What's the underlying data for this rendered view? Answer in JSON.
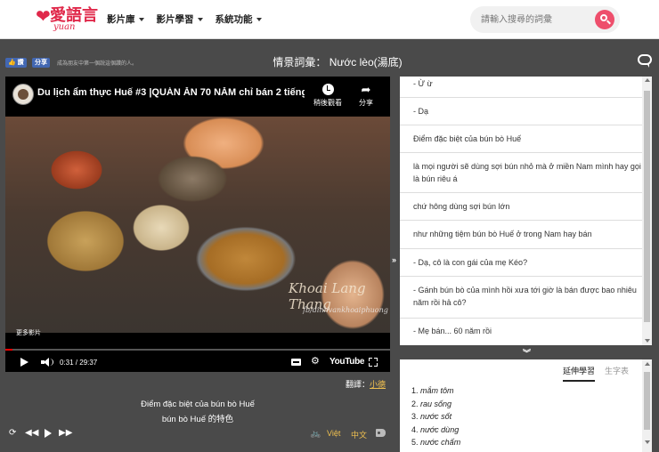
{
  "brand": {
    "logo_text": "愛語言",
    "logo_sub": "yuan",
    "accent": "#e0284a"
  },
  "nav": {
    "items": [
      {
        "label": "影片庫"
      },
      {
        "label": "影片學習"
      },
      {
        "label": "系統功能"
      }
    ]
  },
  "search": {
    "placeholder": "請輸入搜尋的詞彙",
    "icon": "search-icon"
  },
  "social": {
    "like_label": "讚",
    "share_label": "分享",
    "note": "成為朋友中第一個說這個讚的人。"
  },
  "page": {
    "title": "情景詞彙： Nước lèo(湯底)"
  },
  "video": {
    "title": "Du lịch ẩm thực Huế #3 |QUÁN ĂN 70 NĂM chỉ bán 2 tiếng mỗi...",
    "watch_later_label": "稍後觀看",
    "share_label": "分享",
    "more_videos_label": "更多影片",
    "time": "0:31 / 29:37",
    "progress_fraction": 0.0174,
    "brand_label": "YouTube",
    "watermark": "Khoai Lang Thang",
    "watermark_sub": "fb/dinhvankhoaiphuong"
  },
  "translate": {
    "label": "翻譯：",
    "link": "小德"
  },
  "current_sub": {
    "vi": "Điểm đặc biệt của bún bò Huế",
    "zh": "bún bò Huế 的特色"
  },
  "sub_controls": {
    "lang_vi": "Việt",
    "lang_zh": "中文"
  },
  "subtitle_list": [
    {
      "text": "- Ừ ừ"
    },
    {
      "text": "- Dạ"
    },
    {
      "text": "Điểm đặc biệt của bún bò Huế"
    },
    {
      "text": "là mọi người sẽ dùng sợi bún nhỏ mà ở miền Nam mình hay gọi là bún riêu á"
    },
    {
      "text": "chứ hông dùng sợi bún lớn"
    },
    {
      "text": "như những tiệm bún bò Huế ở trong Nam hay bán"
    },
    {
      "text": "- Dạ, cô là con gái của mẹ Kéo?"
    },
    {
      "text": "- Gánh bún bò của mình hồi xưa tới giờ là bán được bao nhiêu năm rồi hả cô?"
    },
    {
      "text": "- Mẹ bán... 60 năm rồi"
    }
  ],
  "vocab_panel": {
    "tabs": [
      {
        "label": "延伸學習"
      },
      {
        "label": "生字表"
      }
    ],
    "words": [
      {
        "num": "1.",
        "word": "mắm tôm"
      },
      {
        "num": "2.",
        "word": "rau sống"
      },
      {
        "num": "3.",
        "word": "nước sốt"
      },
      {
        "num": "4.",
        "word": "nước dùng"
      },
      {
        "num": "5.",
        "word": "nước chấm"
      }
    ]
  }
}
